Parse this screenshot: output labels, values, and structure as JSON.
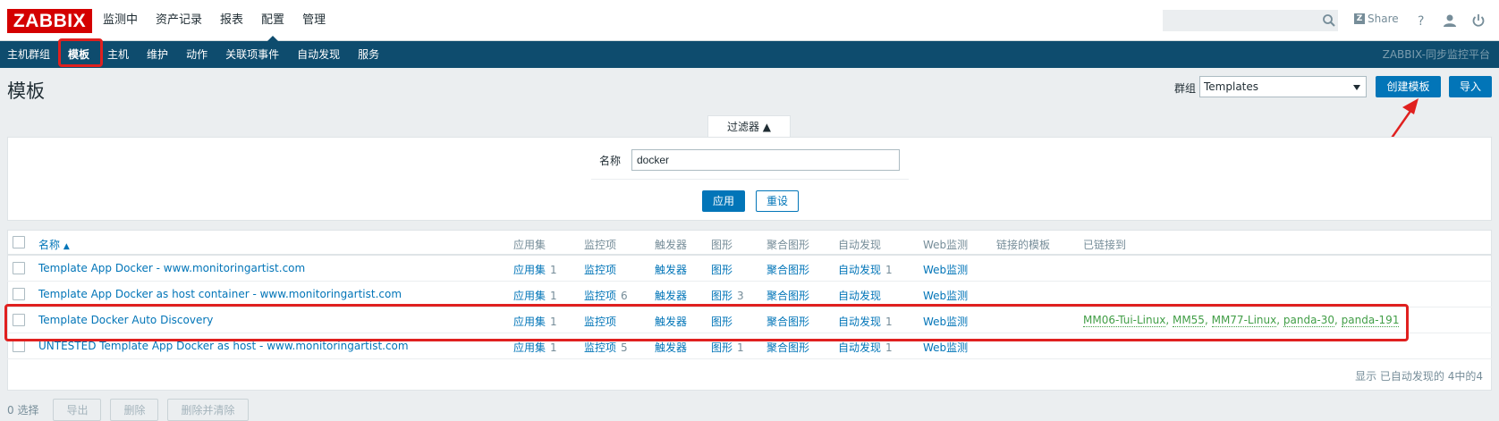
{
  "topbar": {
    "logo": "ZABBIX",
    "main_menu": [
      "监测中",
      "资产记录",
      "报表",
      "配置",
      "管理"
    ],
    "active_main": "配置",
    "search_placeholder": "",
    "share_label": "Share",
    "help_icon": "help-icon",
    "user_icon": "user-icon",
    "logout_icon": "power-icon"
  },
  "submenu": {
    "items": [
      "主机群组",
      "模板",
      "主机",
      "维护",
      "动作",
      "关联项事件",
      "自动发现",
      "服务"
    ],
    "active": "模板",
    "brand": "ZABBIX-同步监控平台"
  },
  "page": {
    "title": "模板",
    "group_label": "群组",
    "group_value": "Templates",
    "create_button": "创建模板",
    "import_button": "导入"
  },
  "filter": {
    "tab_label": "过滤器 ▲",
    "name_label": "名称",
    "name_value": "docker",
    "apply_button": "应用",
    "reset_button": "重设"
  },
  "table": {
    "headers": {
      "name": "名称",
      "applications": "应用集",
      "items": "监控项",
      "triggers": "触发器",
      "graphs": "图形",
      "screens": "聚合图形",
      "discovery": "自动发现",
      "web": "Web监测",
      "linked_templates": "链接的模板",
      "linked_to": "已链接到"
    },
    "rows": [
      {
        "name": "Template App Docker - www.monitoringartist.com",
        "applications": "应用集",
        "applications_count": "1",
        "items": "监控项",
        "items_count": "",
        "triggers": "触发器",
        "graphs": "图形",
        "graphs_count": "",
        "screens": "聚合图形",
        "discovery": "自动发现",
        "discovery_count": "1",
        "web": "Web监测",
        "linked_to": []
      },
      {
        "name": "Template App Docker as host container - www.monitoringartist.com",
        "applications": "应用集",
        "applications_count": "1",
        "items": "监控项",
        "items_count": "6",
        "triggers": "触发器",
        "graphs": "图形",
        "graphs_count": "3",
        "screens": "聚合图形",
        "discovery": "自动发现",
        "discovery_count": "",
        "web": "Web监测",
        "linked_to": []
      },
      {
        "name": "Template Docker Auto Discovery",
        "applications": "应用集",
        "applications_count": "1",
        "items": "监控项",
        "items_count": "",
        "triggers": "触发器",
        "graphs": "图形",
        "graphs_count": "",
        "screens": "聚合图形",
        "discovery": "自动发现",
        "discovery_count": "1",
        "web": "Web监测",
        "linked_to": [
          "MM06-Tui-Linux",
          "MM55",
          "MM77-Linux",
          "panda-30",
          "panda-191"
        ]
      },
      {
        "name": "UNTESTED Template App Docker as host - www.monitoringartist.com",
        "applications": "应用集",
        "applications_count": "1",
        "items": "监控项",
        "items_count": "5",
        "triggers": "触发器",
        "graphs": "图形",
        "graphs_count": "1",
        "screens": "聚合图形",
        "discovery": "自动发现",
        "discovery_count": "1",
        "web": "Web监测",
        "linked_to": []
      }
    ],
    "footer": "显示 已自动发现的 4中的4"
  },
  "actions": {
    "selected": "0 选择",
    "export": "导出",
    "delete": "删除",
    "delete_clear": "删除并清除"
  },
  "colors": {
    "accent": "#0275b8",
    "nav_bg": "#0e4c6e",
    "highlight": "#e0201f",
    "linked_host": "#429e47"
  }
}
